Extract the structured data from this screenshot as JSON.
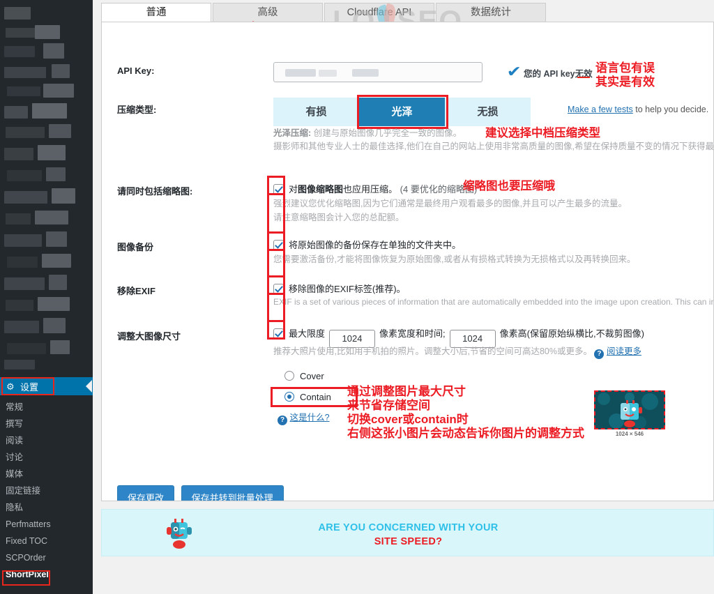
{
  "sidebar": {
    "settings_item": {
      "label": "设置",
      "icon": "settings-gear-icon"
    },
    "items": [
      {
        "label": "常规"
      },
      {
        "label": "撰写"
      },
      {
        "label": "阅读"
      },
      {
        "label": "讨论"
      },
      {
        "label": "媒体"
      },
      {
        "label": "固定链接"
      },
      {
        "label": "隐私"
      },
      {
        "label": "Perfmatters"
      },
      {
        "label": "Fixed TOC"
      },
      {
        "label": "SCPOrder"
      },
      {
        "label": "ShortPixel",
        "active": true
      }
    ]
  },
  "tabs": [
    {
      "label": "普通",
      "active": true
    },
    {
      "label": "高级",
      "active": false
    },
    {
      "label": "Cloudflare API",
      "active": false
    },
    {
      "label": "数据统计",
      "active": false
    }
  ],
  "watermark": {
    "text_left": "LO",
    "text_right": "SEO"
  },
  "api_key": {
    "label": "API Key:",
    "value": "",
    "placeholder": "",
    "status_text": "您的 API key无效",
    "check_icon": "check-mark-icon"
  },
  "compression": {
    "label": "压缩类型:",
    "options": [
      {
        "label": "有损",
        "selected": false
      },
      {
        "label": "光泽",
        "selected": true
      },
      {
        "label": "无损",
        "selected": false
      }
    ],
    "help_link": "Make a few tests",
    "help_rest": " to help you decide.",
    "desc_strong": "光泽压缩:",
    "desc_line1": " 创建与原始图像几乎完全一致的图像。",
    "desc_line2": "摄影师和其他专业人士的最佳选择,他们在自己的网站上使用非常高质量的图像,希望在保持质量不变的情况下获得最佳压缩效果。"
  },
  "thumbnails": {
    "label": "请同时包括缩略图:",
    "checkbox_checked": true,
    "cb_text_pre": "对",
    "cb_text_bold": "图像缩略图",
    "cb_text_post": "也应用压缩。",
    "cb_text_count": "(4 要优化的缩略图)",
    "desc_line1": "强烈建议您优化缩略图,因为它们通常是最终用户观看最多的图像,并且可以产生最多的流量。",
    "desc_line2": "请注意缩略图会计入您的总配额。"
  },
  "backup": {
    "label": "图像备份",
    "checkbox_checked": true,
    "cb_text": "将原始图像的备份保存在单独的文件夹中。",
    "desc_line1": "您需要激活备份,才能将图像恢复为原始图像,或者从有损格式转换为无损格式以及再转换回来。"
  },
  "exif": {
    "label": "移除EXIF",
    "checkbox_checked": true,
    "cb_text": "移除图像的EXIF标签(推荐)。",
    "desc_line1": "EXIF is a set of various pieces of information that are automatically embedded into the image upon creation. This can include GPS p"
  },
  "resize": {
    "label": "调整大图像尺寸",
    "checkbox_checked": true,
    "cb_prefix": "最大限度",
    "width_value": "1024",
    "cb_middle": "像素宽度和时间;",
    "height_value": "1024",
    "cb_suffix": "像素高(保留原始纵横比,不裁剪图像)",
    "desc_line1": "推荐大照片使用,比如用手机拍的照片。调整大小后,节省的空间可高达80%或更多。",
    "help_icon": "question-mark-icon",
    "read_more": "阅读更多",
    "fit_options": [
      {
        "label": "Cover",
        "selected": false
      },
      {
        "label": "Contain",
        "selected": true
      }
    ],
    "what_is_this_icon": "question-mark-icon",
    "what_is_this": "这是什么?",
    "preview_size_label": "1024 × 546"
  },
  "buttons": {
    "save": "保存更改",
    "save_and_bulk": "保存并转到批量处理"
  },
  "banner": {
    "line1": "ARE YOU CONCERNED WITH YOUR",
    "line2": "SITE SPEED?",
    "mascot_icon": "robot-mascot-icon"
  },
  "annotations": [
    {
      "id": "api-key-note",
      "lines": [
        "语言包有误",
        "其实是有效"
      ]
    },
    {
      "id": "compression-note",
      "lines": [
        "建议选择中档压缩类型"
      ]
    },
    {
      "id": "thumbnail-note",
      "lines": [
        "缩略图也要压缩哦"
      ]
    },
    {
      "id": "resize-note",
      "lines": [
        "通过调整图片最大尺寸",
        "来节省存储空间",
        "切换cover或contain时",
        "右侧这张小图片会动态告诉你图片的调整方式"
      ]
    }
  ],
  "colors": {
    "annotation_red": "#ec1c24",
    "accent_blue": "#2271b1",
    "segment_selected": "#1f7fb5",
    "sidebar_bg": "#23282d",
    "banner_bg": "#d9f6fb"
  }
}
